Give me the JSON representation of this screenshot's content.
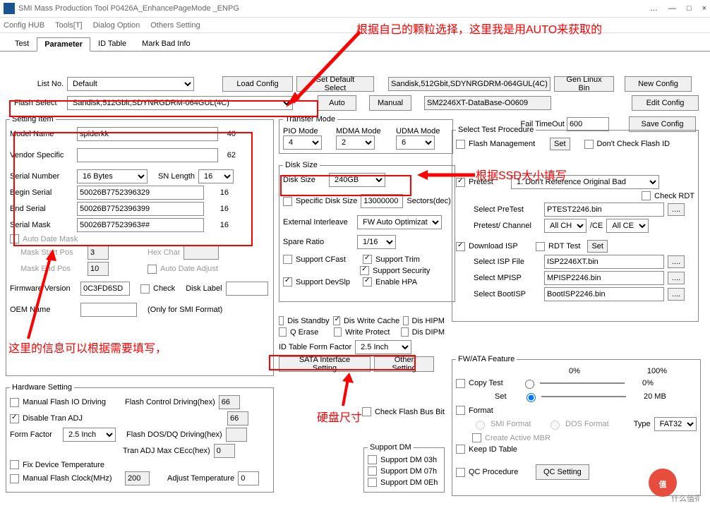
{
  "window": {
    "title": "SMI Mass Production Tool P0426A_EnhancePageMode    _ENPG",
    "min": "—",
    "max": "□",
    "close": "×",
    "more": "…"
  },
  "menu": {
    "config_hub": "Config HUB",
    "tools": "Tools[T]",
    "dialog_option": "Dialog Option",
    "others": "Others Setting"
  },
  "tabs": {
    "test": "Test",
    "parameter": "Parameter",
    "id_table": "ID Table",
    "mark_bad": "Mark Bad Info"
  },
  "toprow": {
    "list_no_lbl": "List No.",
    "list_no_val": "Default",
    "load_config": "Load Config",
    "set_default": "Set Default Select",
    "device_info": "Sandisk,512Gbit,SDYNRGDRM-064GUL(4C)",
    "gen_linux": "Gen Linux Bin",
    "new_config": "New Config"
  },
  "flash_select": {
    "lbl": "Flash Select",
    "val": "Sandisk,512Gbit,SDYNRGDRM-064GUL(4C)",
    "auto": "Auto",
    "manual": "Manual",
    "database": "SM2246XT-DataBase-O0609",
    "edit_config": "Edit Config"
  },
  "fail_timeout": {
    "lbl": "Fail TimeOut",
    "val": "600",
    "save": "Save Config"
  },
  "setting_item": {
    "legend": "Setting Item",
    "model_name_lbl": "Model Name",
    "model_name_val": "spiderkk",
    "model_name_len": "40",
    "vendor_lbl": "Vendor Specific",
    "vendor_val": "",
    "vendor_len": "62",
    "serial_num_lbl": "Serial Number",
    "serial_num_val": "16 Bytes",
    "sn_length_lbl": "SN Length",
    "sn_length_val": "16",
    "begin_lbl": "Begin Serial",
    "begin_val": "50026B7752396329",
    "begin_len": "16",
    "end_lbl": "End Serial",
    "end_val": "50026B7752396399",
    "end_len": "16",
    "mask_lbl": "Serial Mask",
    "mask_val": "50026B77523963##",
    "mask_len": "16",
    "auto_date_mask": "Auto Date Mask",
    "mask_start_lbl": "Mask Start Pos",
    "mask_start_val": "3",
    "hex_char_lbl": "Hex Char",
    "mask_end_lbl": "Mask End Pos",
    "mask_end_val": "10",
    "auto_date_adjust": "Auto Date Adjust",
    "fw_lbl": "Firmware Version",
    "fw_val": "0C3FD6SD",
    "check_lbl": "Check",
    "disk_label_lbl": "Disk Label",
    "oem_lbl": "OEM Name",
    "oem_note": "(Only for SMI Format)"
  },
  "transfer": {
    "legend": "Transfer Mode",
    "pio_lbl": "PIO Mode",
    "pio_val": "4",
    "mdma_lbl": "MDMA Mode",
    "mdma_val": "2",
    "udma_lbl": "UDMA Mode",
    "udma_val": "6"
  },
  "disk_size": {
    "legend": "Disk Size",
    "lbl": "Disk Size",
    "val": "240GB",
    "specific_lbl": "Specific Disk Size",
    "specific_val": "13000000",
    "sectors": "Sectors(dec)",
    "ext_lbl": "External Interleave",
    "ext_val": "FW Auto Optimization",
    "spare_lbl": "Spare Ratio",
    "spare_val": "1/16",
    "cfast": "Support CFast",
    "trim": "Support Trim",
    "security": "Support Security",
    "devslp": "Support DevSlp",
    "hpa": "Enable HPA"
  },
  "misc": {
    "dis_standby": "Dis Standby",
    "dis_wcache": "Dis Write Cache",
    "dis_hipm": "Dis HIPM",
    "q_erase": "Q Erase",
    "write_protect": "Write Protect",
    "dis_dipm": "Dis DIPM",
    "form_factor_lbl": "ID Table Form Factor",
    "form_factor_val": "2.5 Inch",
    "sata_setting": "SATA Interface Setting",
    "other_setting": "Other Setting",
    "check_flash_bus": "Check Flash Bus Bit"
  },
  "hw": {
    "legend": "Hardware Setting",
    "manual_io": "Manual Flash IO Driving",
    "ctrl_drv_lbl": "Flash Control Driving(hex)",
    "ctrl_drv_val": "66",
    "disable_tran": "Disable Tran ADJ",
    "disable_tran_val": "66",
    "ff_lbl": "Form Factor",
    "ff_val": "2.5 Inch",
    "dos_dq_lbl": "Flash DOS/DQ Driving(hex)",
    "tran_max_lbl": "Tran ADJ Max CEcc(hex)",
    "tran_max_val": "0",
    "fix_temp": "Fix Device Temperature",
    "manual_clock": "Manual Flash Clock(MHz)",
    "manual_clock_val": "200",
    "adjust_temp_lbl": "Adjust Temperature",
    "adjust_temp_val": "0"
  },
  "support_dm": {
    "legend": "Support DM",
    "dm03": "Support DM 03h",
    "dm07": "Support DM 07h",
    "dm0e": "Support DM 0Eh"
  },
  "select_test": {
    "legend": "Select Test Procedure",
    "flash_mgmt": "Flash Management",
    "set": "Set",
    "dont_check": "Don't Check Flash ID",
    "pretest_lbl": "Pretest",
    "pretest_val": "1. Don't Reference Original Bad",
    "check_rdt": "Check RDT",
    "select_pretest_lbl": "Select PreTest",
    "select_pretest_val": "PTEST2246.bin",
    "pretest_ch_lbl": "Pretest/ Channel",
    "pretest_ch_val": "All CH",
    "ce_lbl": "/CE",
    "ce_val": "All CE",
    "download_isp": "Download ISP",
    "rdt_test": "RDT Test",
    "isp_file_lbl": "Select ISP File",
    "isp_file_val": "ISP2246XT.bin",
    "mpisp_lbl": "Select MPISP",
    "mpisp_val": "MPISP2246.bin",
    "bootisp_lbl": "Select BootISP",
    "bootisp_val": "BootISP2246.bin",
    "ellipsis": "...."
  },
  "fw_ata": {
    "legend": "FW/ATA Feature",
    "pct0": "0%",
    "pct100": "100%",
    "copy_test": "Copy Test",
    "copy_test_pct": "0%",
    "set_lbl": "Set",
    "set_val": "20 MB",
    "format": "Format",
    "smi_format": "SMI Format",
    "dos_format": "DOS Format",
    "create_mbr": "Create Active MBR",
    "type_lbl": "Type",
    "type_val": "FAT32",
    "keep_id": "Keep ID Table",
    "qc_procedure": "QC Procedure",
    "qc_setting": "QC Setting"
  },
  "annotations": {
    "note1": "根据自己的颗粒选择，这里我是用AUTO来获取的",
    "note2": "根据SSD大小填写",
    "note3": "这里的信息可以根据需要填写，",
    "note4": "硬盘尺寸"
  },
  "watermark": {
    "text": "什么值得买"
  }
}
